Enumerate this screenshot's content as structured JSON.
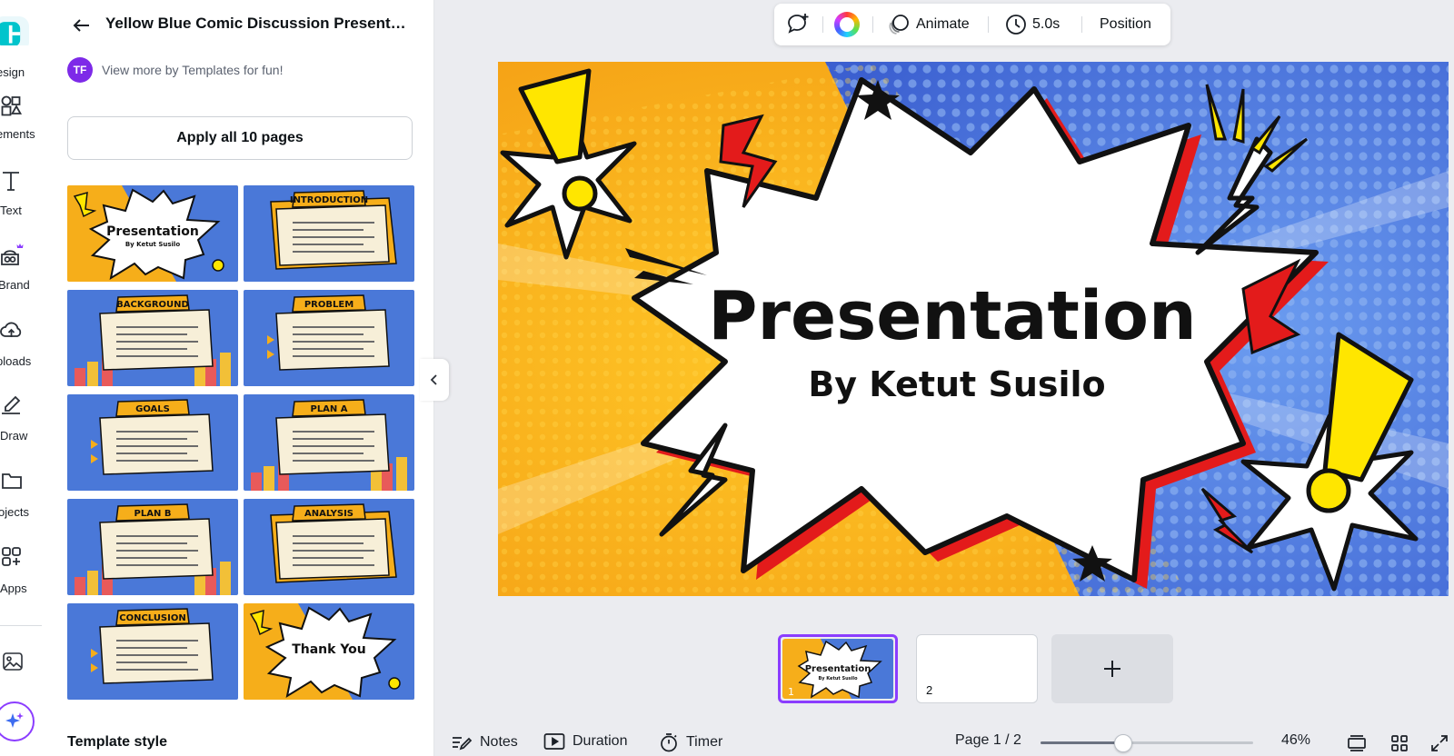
{
  "rail": {
    "items": [
      {
        "label": "esign",
        "icon": "design-icon"
      },
      {
        "label": "ements",
        "icon": "elements-icon"
      },
      {
        "label": "Text",
        "icon": "text-icon"
      },
      {
        "label": "Brand",
        "icon": "brand-icon"
      },
      {
        "label": "ploads",
        "icon": "uploads-icon"
      },
      {
        "label": "Draw",
        "icon": "draw-icon"
      },
      {
        "label": "ojects",
        "icon": "projects-icon"
      },
      {
        "label": "Apps",
        "icon": "apps-icon"
      }
    ]
  },
  "panel": {
    "title": "Yellow Blue Comic Discussion Presentati...",
    "author_initials": "TF",
    "author_link": "View more by Templates for fun!",
    "apply_button": "Apply all 10 pages",
    "template_style_heading": "Template style",
    "thumbnails": [
      {
        "label": "Presentation",
        "sub": "By Ketut Susilo",
        "style": "cover"
      },
      {
        "label": "INTRODUCTION",
        "style": "yellow-box"
      },
      {
        "label": "BACKGROUND",
        "style": "city"
      },
      {
        "label": "PROBLEM",
        "style": "list"
      },
      {
        "label": "GOALS",
        "style": "list-left"
      },
      {
        "label": "PLAN A",
        "style": "city"
      },
      {
        "label": "PLAN B",
        "style": "city"
      },
      {
        "label": "ANALYSIS",
        "style": "yellow-box"
      },
      {
        "label": "CONCLUSION",
        "style": "list"
      },
      {
        "label": "Thank You",
        "style": "cover"
      }
    ]
  },
  "toolbar": {
    "animate_label": "Animate",
    "duration_label": "5.0s",
    "position_label": "Position"
  },
  "canvas": {
    "title": "Presentation",
    "subtitle": "By Ketut Susilo"
  },
  "pages": {
    "thumb1_title": "Presentation",
    "thumb1_sub": "By Ketut Susilo",
    "thumb1_number": "1",
    "thumb2_number": "2"
  },
  "footer": {
    "notes_label": "Notes",
    "duration_label": "Duration",
    "timer_label": "Timer",
    "page_indicator": "Page 1 / 2",
    "zoom_fraction": 0.39,
    "zoom_label": "46%"
  },
  "colors": {
    "accent": "#8b3dff",
    "comic_yellow": "#f7b21a",
    "comic_blue": "#4a78d8",
    "avatar": "#7d2ae8"
  }
}
